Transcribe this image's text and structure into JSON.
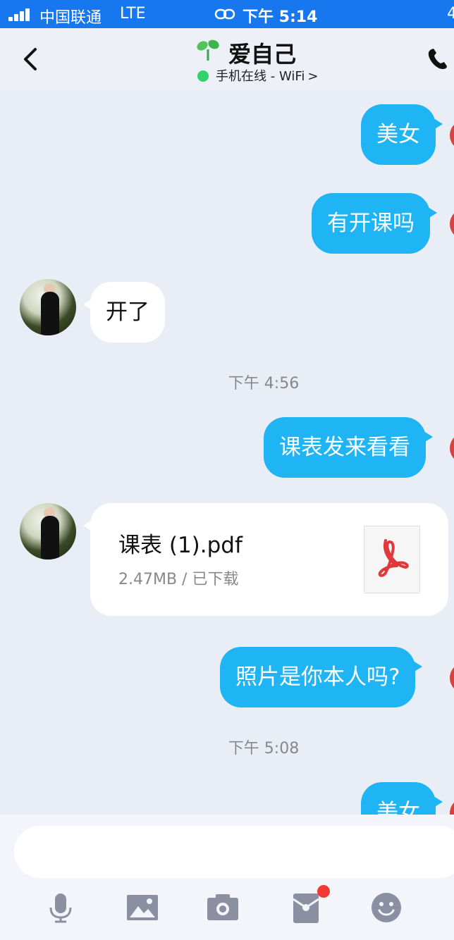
{
  "status_bar": {
    "carrier": "中国联通",
    "network": "LTE",
    "time": "下午 5:14",
    "battery_partial": "4"
  },
  "header": {
    "title": "爱自己",
    "presence": "手机在线 - WiFi",
    "presence_chevron": ">"
  },
  "messages": [
    {
      "type": "out",
      "text": "美女"
    },
    {
      "type": "out",
      "text": "有开课吗"
    },
    {
      "type": "in",
      "text": "开了"
    },
    {
      "type": "time",
      "text": "下午 4:56"
    },
    {
      "type": "out",
      "text": "课表发来看看"
    },
    {
      "type": "in_file",
      "file_name": "课表 (1).pdf",
      "file_meta": "2.47MB / 已下载"
    },
    {
      "type": "out",
      "text": "照片是你本人吗?"
    },
    {
      "type": "time",
      "text": "下午 5:08"
    },
    {
      "type": "out",
      "text": "美女"
    }
  ],
  "colors": {
    "status_bar_bg": "#1677ee",
    "outgoing_bubble": "#1fb5f5",
    "incoming_bubble": "#ffffff",
    "chat_bg": "#e9edf5",
    "online_dot": "#2fd46a",
    "badge": "#ef3b33",
    "toolbar_icon": "#8a8fa2"
  },
  "toolbar": {
    "icons": [
      "microphone-icon",
      "image-icon",
      "camera-icon",
      "red-packet-icon",
      "emoji-icon"
    ]
  }
}
